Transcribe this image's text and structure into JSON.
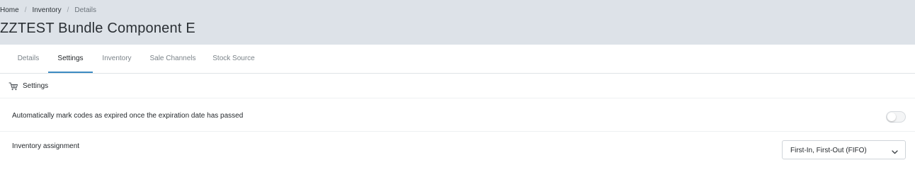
{
  "breadcrumb": {
    "items": [
      "Home",
      "Inventory",
      "Details"
    ],
    "separator": "/"
  },
  "page": {
    "title": "ZZTEST Bundle Component E"
  },
  "tabs": [
    {
      "label": "Details",
      "active": false
    },
    {
      "label": "Settings",
      "active": true
    },
    {
      "label": "Inventory",
      "active": false
    },
    {
      "label": "Sale Channels",
      "active": false
    },
    {
      "label": "Stock Source",
      "active": false
    }
  ],
  "settings": {
    "icon": "settings-cart-icon",
    "title": "Settings",
    "expire_codes": {
      "label": "Automatically mark codes as expired once the expiration date has passed",
      "enabled": false
    },
    "inventory_assignment": {
      "label": "Inventory assignment",
      "selected": "First-In, First-Out (FIFO)",
      "icon": "chevron-down-icon"
    }
  },
  "colors": {
    "header_bg": "#dde2e8",
    "active_tab_underline": "#3d8bc2",
    "inactive_tab_text": "#7b8389"
  }
}
